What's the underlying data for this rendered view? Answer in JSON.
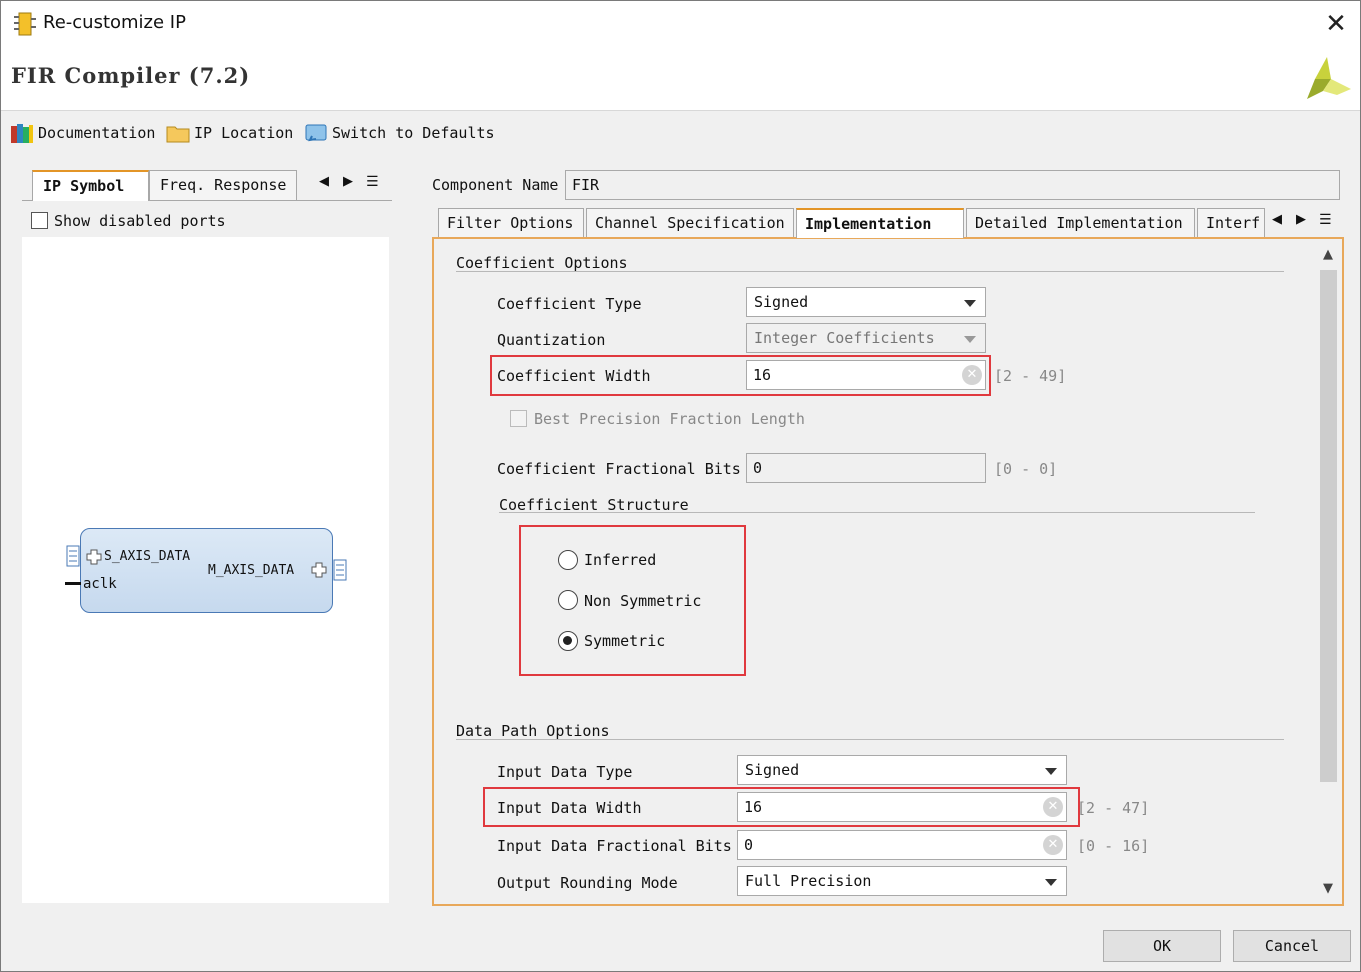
{
  "window": {
    "title": "Re-customize IP",
    "close_glyph": "✕"
  },
  "header": {
    "title": "FIR Compiler (7.2)",
    "logo_icon": "xilinx-logo-icon"
  },
  "toolbar": {
    "documentation": "Documentation",
    "ip_location": "IP Location",
    "switch_defaults": "Switch to Defaults"
  },
  "left": {
    "tabs": [
      "IP Symbol",
      "Freq. Response"
    ],
    "show_disabled": "Show disabled ports",
    "symbol": {
      "in_port": "S_AXIS_DATA",
      "out_port": "M_AXIS_DATA",
      "clock": "aclk"
    }
  },
  "component": {
    "label": "Component Name",
    "value": "FIR"
  },
  "tabs": [
    "Filter Options",
    "Channel Specification",
    "Implementation",
    "Detailed Implementation",
    "Interf"
  ],
  "coef": {
    "section": "Coefficient Options",
    "type_label": "Coefficient Type",
    "type_value": "Signed",
    "quant_label": "Quantization",
    "quant_value": "Integer Coefficients",
    "width_label": "Coefficient Width",
    "width_value": "16",
    "width_range": "[2 - 49]",
    "best_precision": "Best Precision Fraction Length",
    "frac_label": "Coefficient Fractional Bits",
    "frac_value": "0",
    "frac_range": "[0 - 0]",
    "structure_section": "Coefficient Structure",
    "structure_options": [
      "Inferred",
      "Non Symmetric",
      "Symmetric"
    ],
    "structure_selected": "Symmetric"
  },
  "datapath": {
    "section": "Data Path Options",
    "in_type_label": "Input Data Type",
    "in_type_value": "Signed",
    "in_width_label": "Input Data Width",
    "in_width_value": "16",
    "in_width_range": "[2 - 47]",
    "in_frac_label": "Input Data Fractional Bits",
    "in_frac_value": "0",
    "in_frac_range": "[0 - 16]",
    "round_label": "Output Rounding Mode",
    "round_value": "Full Precision"
  },
  "buttons": {
    "ok": "OK",
    "cancel": "Cancel"
  },
  "colors": {
    "highlight": "#e0393e",
    "tab_accent": "#e39527",
    "panel_border": "#e8a85a"
  }
}
